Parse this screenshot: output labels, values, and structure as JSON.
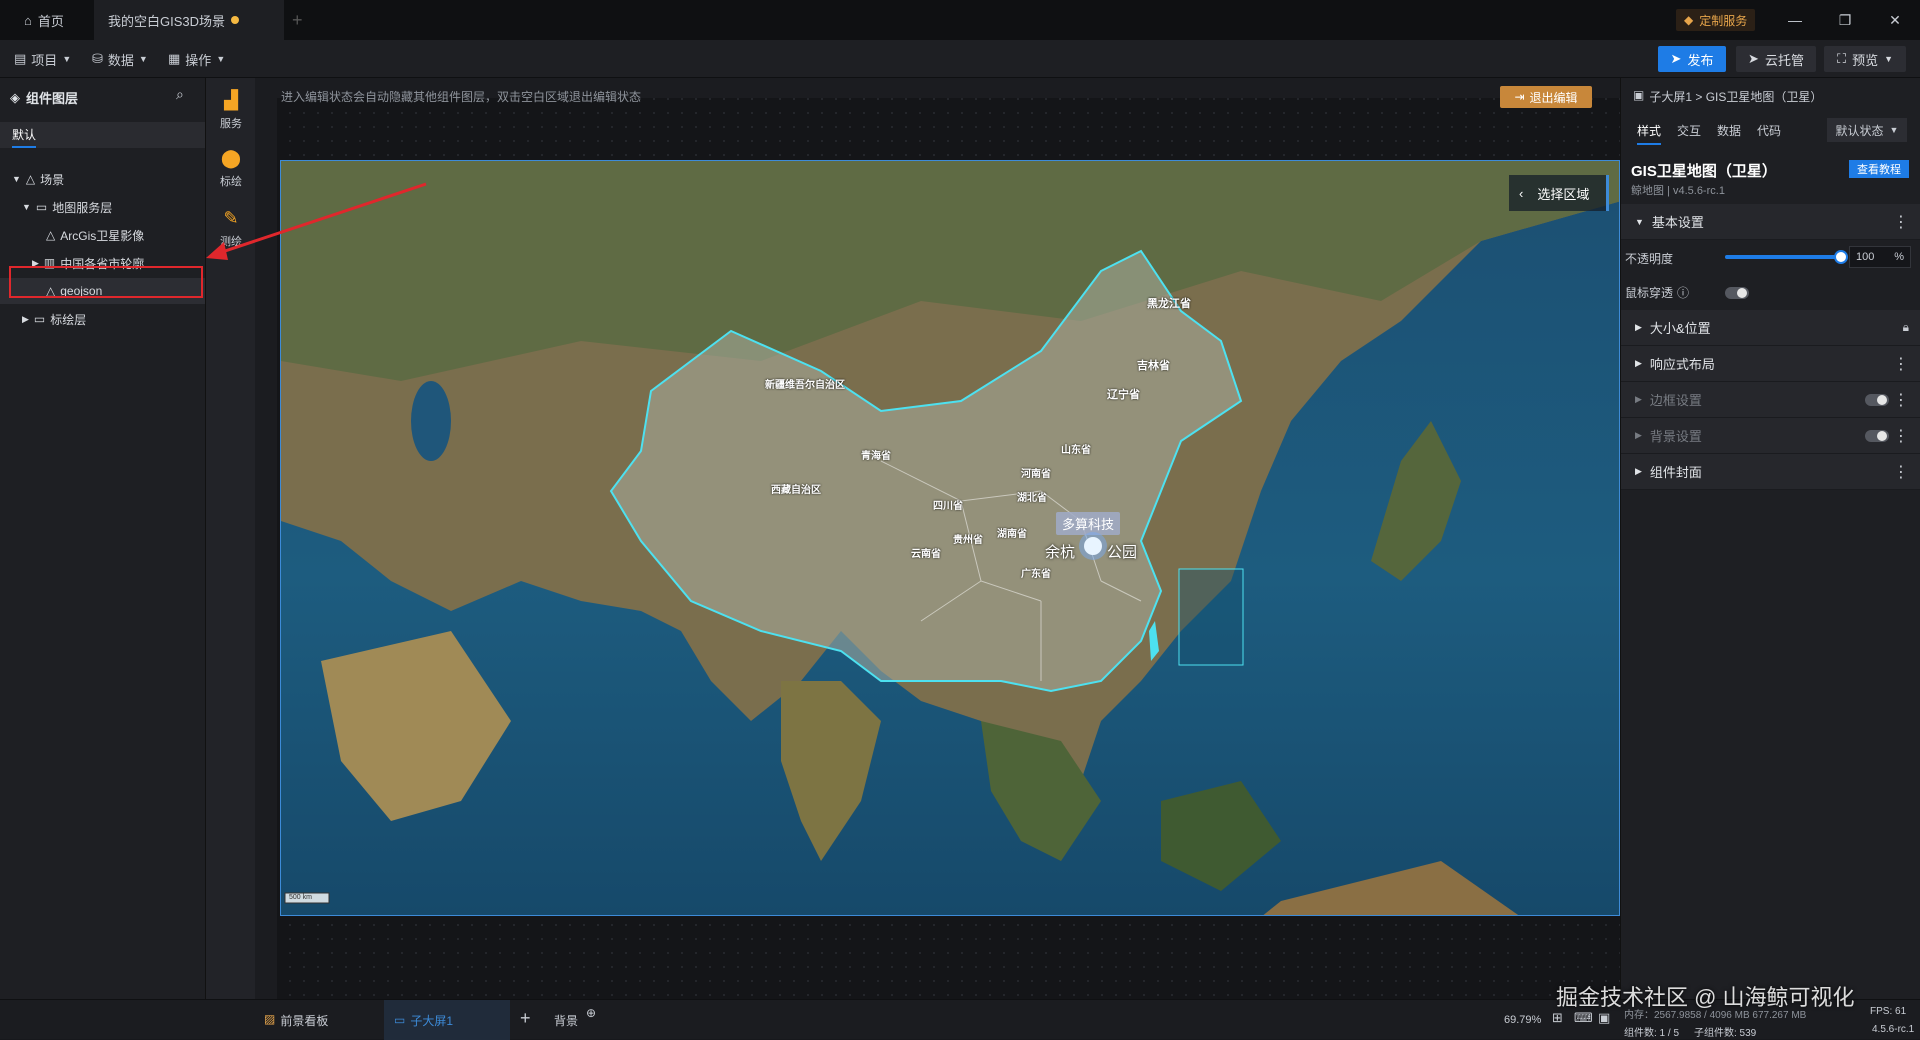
{
  "titlebar": {
    "home_tab": "首页",
    "doc_tab": "我的空白GIS3D场景",
    "custom_service": "定制服务",
    "colors": {
      "unsaved_dot": "#f5b942",
      "accent": "#1e7ce6"
    }
  },
  "toolbar": {
    "project": "项目",
    "data": "数据",
    "operation": "操作",
    "publish": "发布",
    "cloud": "云托管",
    "preview": "预览"
  },
  "layers": {
    "title": "组件图层",
    "tab_default": "默认",
    "tree": [
      {
        "label": "场景",
        "icon": "scene-icon"
      },
      {
        "label": "地图服务层",
        "icon": "folder-icon"
      },
      {
        "label": "ArcGis卫星影像",
        "icon": "scene-icon"
      },
      {
        "label": "中国各省市轮廓",
        "icon": "map-icon"
      },
      {
        "label": "geojson",
        "icon": "scene-icon",
        "selected": true
      },
      {
        "label": "标绘层",
        "icon": "folder-icon"
      }
    ]
  },
  "tools": [
    {
      "label": "服务",
      "icon": "map-service-icon"
    },
    {
      "label": "标绘",
      "icon": "marker-icon"
    },
    {
      "label": "测绘",
      "icon": "measure-icon"
    }
  ],
  "canvas": {
    "hint": "进入编辑状态会自动隐藏其他组件图层，双击空白区域退出编辑状态",
    "exit_edit": "退出编辑",
    "select_area": "选择区域",
    "scale_label": "500 km",
    "tooltip": "多算科技",
    "poi": "余杭",
    "poi_suffix": "公园",
    "province_labels": [
      "黑龙江省",
      "吉林省",
      "辽宁省",
      "新疆维吾尔自治区",
      "西藏自治区",
      "青海省",
      "山东省",
      "河南省",
      "湖北省",
      "四川省",
      "湖南省",
      "贵州省",
      "云南省",
      "广东省"
    ]
  },
  "props": {
    "breadcrumb": "子大屏1 > GIS卫星地图（卫星）",
    "tabs": [
      "样式",
      "交互",
      "数据",
      "代码"
    ],
    "state": "默认状态",
    "component_name": "GIS卫星地图（卫星）",
    "version": "鲸地图 | v4.5.6-rc.1",
    "tutorial": "查看教程",
    "basic": "基本设置",
    "opacity_label": "不透明度",
    "opacity_value": "100",
    "opacity_unit": "%",
    "opacity_fraction": 1.0,
    "mouse_through": "鼠标穿透",
    "sections": [
      "大小&位置",
      "响应式布局",
      "边框设置",
      "背景设置",
      "组件封面"
    ]
  },
  "bottom": {
    "front_board": "前景看板",
    "child_screen": "子大屏1",
    "background": "背景",
    "zoom": "69.79%",
    "status_top": "内存：2567.9858 / 4096 MB 677.267 MB",
    "fps": "FPS: 61",
    "components": "组件数: 1 / 5",
    "sub_components": "子组件数: 539",
    "version": "4.5.6-rc.1",
    "watermark": "掘金技术社区 @ 山海鲸可视化"
  }
}
